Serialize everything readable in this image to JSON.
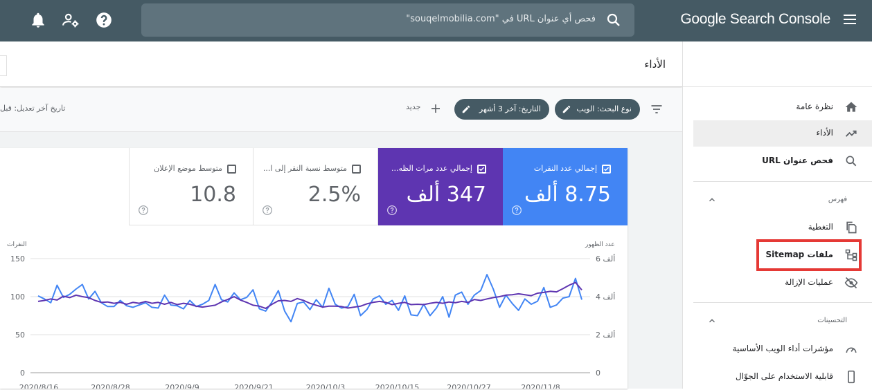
{
  "topbar": {
    "brand": "Google Search Console",
    "search_placeholder": "فحص أي عنوان URL في \"souqelmobilia.com\""
  },
  "page": {
    "title": "الأداء",
    "last_modified": "تاريخ آخر تعديل: قبل"
  },
  "filters": {
    "search_type": "نوع البحث: الويب",
    "date": "التاريخ: آخر 3 أشهر",
    "new_label": "جديد"
  },
  "sidebar": {
    "items": [
      {
        "label": "نظرة عامة"
      },
      {
        "label": "الأداء"
      },
      {
        "label": "فحص عنوان URL"
      }
    ],
    "index_section": "فهرس",
    "index_items": [
      {
        "label": "التغطية"
      },
      {
        "label": "ملفات Sitemap"
      },
      {
        "label": "عمليات الإزالة"
      }
    ],
    "enhancements_section": "التحسينات",
    "enh_items": [
      {
        "label": "مؤشرات أداء الويب الأساسية"
      },
      {
        "label": "قابلية الاستخدام على الجوّال"
      }
    ]
  },
  "metrics": [
    {
      "label": "إجمالي عدد النقرات",
      "value": "8.75 ألف",
      "checked": true,
      "color": "#4285f4"
    },
    {
      "label": "إجمالي عدد مرات الظه...",
      "value": "347 ألف",
      "checked": true,
      "color": "#5e35b1"
    },
    {
      "label": "متوسط نسبة النقر إلى ا...",
      "value": "2.5%",
      "checked": false,
      "color": "#ffffff"
    },
    {
      "label": "متوسط موضع الإعلان",
      "value": "10.8",
      "checked": false,
      "color": "#ffffff"
    }
  ],
  "chart_data": {
    "type": "line",
    "left_axis_title": "النقرات",
    "right_axis_title": "عدد الظهور",
    "left_ticks": [
      "150",
      "100",
      "50",
      "0"
    ],
    "right_ticks": [
      "6 ألف",
      "4 ألف",
      "2 ألف",
      "0"
    ],
    "left_ylim": [
      0,
      150
    ],
    "right_ylim": [
      0,
      6000
    ],
    "x_ticks": [
      "2020/8/16",
      "2020/8/28",
      "2020/9/9",
      "2020/9/21",
      "2020/10/3",
      "2020/10/15",
      "2020/10/27",
      "2020/11/8"
    ],
    "series": [
      {
        "name": "إجمالي عدد النقرات",
        "axis": "left",
        "color": "#4285f4",
        "values": [
          101,
          97,
          92,
          115,
          99,
          103,
          110,
          116,
          97,
          107,
          92,
          87,
          87,
          95,
          88,
          86,
          89,
          92,
          86,
          85,
          102,
          89,
          88,
          84,
          95,
          87,
          90,
          95,
          116,
          96,
          93,
          105,
          96,
          99,
          109,
          84,
          81,
          93,
          108,
          81,
          67,
          91,
          93,
          83,
          96,
          86,
          111,
          90,
          85,
          87,
          103,
          75,
          83,
          97,
          101,
          90,
          95,
          82,
          101,
          76,
          75,
          90,
          75,
          85,
          100,
          73,
          102,
          106,
          90,
          102,
          108,
          129,
          110,
          86,
          102,
          91,
          82,
          97,
          90,
          94,
          112,
          86,
          89,
          98,
          100,
          124,
          96
        ]
      },
      {
        "name": "إجمالي عدد مرات الظه...",
        "axis": "right",
        "color": "#5e35b1",
        "values": [
          3750,
          3800,
          3880,
          3820,
          4020,
          3950,
          4080,
          4000,
          3950,
          3800,
          3700,
          3720,
          3650,
          3700,
          3600,
          3700,
          3650,
          3750,
          3650,
          3700,
          3600,
          3700,
          3580,
          3650,
          3600,
          3500,
          3450,
          3500,
          3550,
          3720,
          3850,
          4000,
          3820,
          3700,
          3550,
          3500,
          3380,
          3600,
          3780,
          3800,
          3750,
          3900,
          3800,
          3650,
          3550,
          3450,
          3500,
          3500,
          3480,
          3400,
          3450,
          3500,
          3620,
          3700,
          3750,
          3700,
          3580,
          3650,
          3700,
          3580,
          3600,
          3580,
          3650,
          3700,
          3650,
          3720,
          3680,
          3750,
          3700,
          3850,
          3800,
          3880,
          3950,
          4000,
          4080,
          4100,
          4150,
          4100,
          4050,
          4180,
          4220,
          4280,
          4250,
          4420,
          4600,
          4750,
          4350
        ]
      }
    ]
  }
}
